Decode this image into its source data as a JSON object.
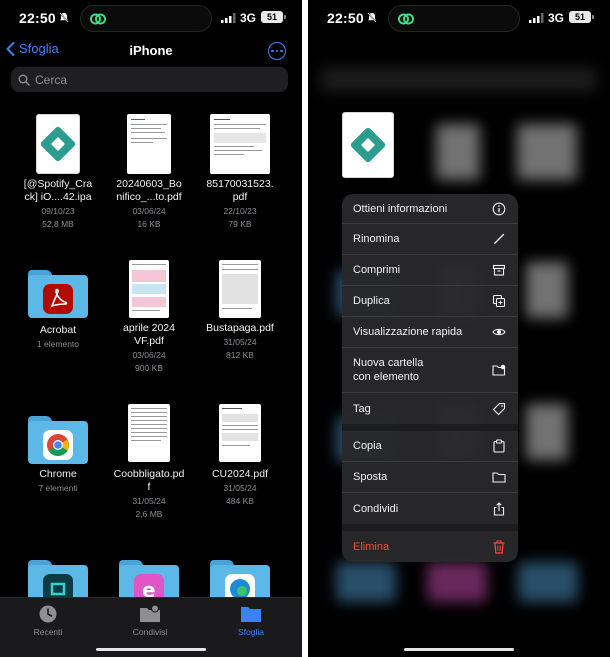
{
  "status": {
    "time": "22:50",
    "network": "3G",
    "battery": "51"
  },
  "nav": {
    "back_label": "Sfoglia",
    "title": "iPhone"
  },
  "search": {
    "placeholder": "Cerca"
  },
  "files": [
    {
      "name_line1": "[@Spotify_Cra",
      "name_line2": "ck] iO....42.ipa",
      "date": "09/10/23",
      "size": "52,8 MB"
    },
    {
      "name_line1": "20240603_Bo",
      "name_line2": "nifico_...to.pdf",
      "date": "03/06/24",
      "size": "16 KB"
    },
    {
      "name_line1": "85170031523.",
      "name_line2": "pdf",
      "date": "22/10/23",
      "size": "79 KB"
    },
    {
      "name_line1": "Acrobat",
      "name_line2": "",
      "date": "1 elemento",
      "size": ""
    },
    {
      "name_line1": "aprile 2024",
      "name_line2": "VF.pdf",
      "date": "03/06/24",
      "size": "900 KB"
    },
    {
      "name_line1": "Bustapaga.pdf",
      "name_line2": "",
      "date": "31/05/24",
      "size": "812 KB"
    },
    {
      "name_line1": "Chrome",
      "name_line2": "",
      "date": "7 elementi",
      "size": ""
    },
    {
      "name_line1": "Coobbligato.pd",
      "name_line2": "f",
      "date": "31/05/24",
      "size": "2,6 MB"
    },
    {
      "name_line1": "CU2024.pdf",
      "name_line2": "",
      "date": "31/05/24",
      "size": "484 KB"
    }
  ],
  "tabbar": {
    "recent": "Recenti",
    "shared": "Condivisi",
    "browse": "Sfoglia"
  },
  "context_menu": [
    {
      "label": "Ottieni informazioni",
      "icon": "info-icon"
    },
    {
      "label": "Rinomina",
      "icon": "pencil-icon"
    },
    {
      "label": "Comprimi",
      "icon": "archive-icon"
    },
    {
      "label": "Duplica",
      "icon": "duplicate-icon"
    },
    {
      "label": "Visualizzazione rapida",
      "icon": "eye-icon"
    },
    {
      "label": "Nuova cartella con elemento",
      "label_line1": "Nuova cartella",
      "label_line2": "con elemento",
      "icon": "folder-plus-icon"
    },
    {
      "label": "Tag",
      "icon": "tag-icon"
    },
    {
      "label": "Copia",
      "icon": "copy-icon"
    },
    {
      "label": "Sposta",
      "icon": "folder-icon"
    },
    {
      "label": "Condividi",
      "icon": "share-icon"
    },
    {
      "label": "Elimina",
      "icon": "trash-icon",
      "destructive": true
    }
  ],
  "colors": {
    "accent": "#3b82f6",
    "destructive": "#ff453a",
    "background": "#000000"
  }
}
